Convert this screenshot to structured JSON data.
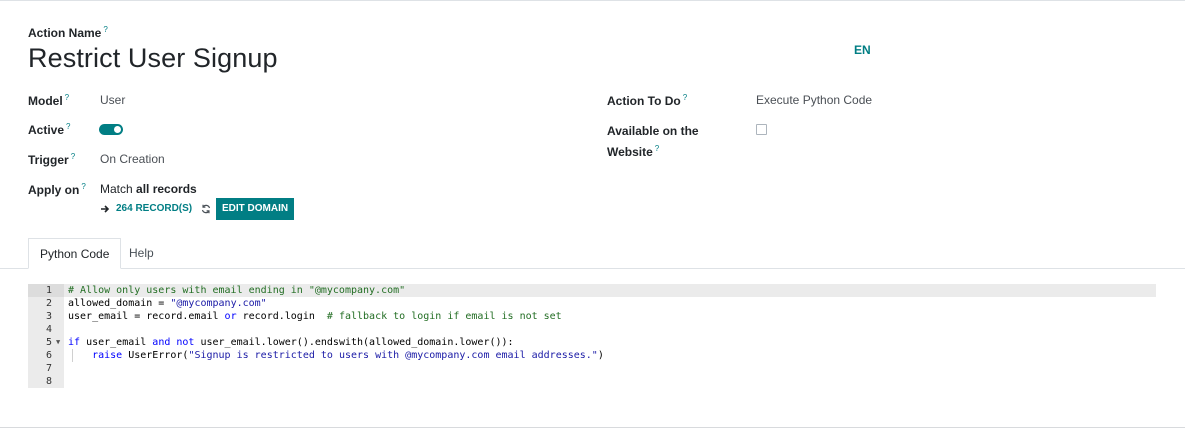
{
  "form": {
    "action_name_label": "Action Name",
    "action_name_help": "?",
    "title": "Restrict User Signup",
    "lang": "EN",
    "model_label": "Model",
    "model_value": "User",
    "active_label": "Active",
    "active_value": true,
    "trigger_label": "Trigger",
    "trigger_value": "On Creation",
    "apply_on_label": "Apply on",
    "apply_on_prefix": "Match ",
    "apply_on_bold": "all records",
    "records_link": "264 RECORD(S)",
    "edit_domain_label": "EDIT DOMAIN",
    "action_to_do_label": "Action To Do",
    "action_to_do_value": "Execute Python Code",
    "available_website_label_line1": "Available on the",
    "available_website_label_line2": "Website",
    "available_website_value": false,
    "help_mark": "?"
  },
  "tabs": [
    {
      "label": "Python Code",
      "active": true
    },
    {
      "label": "Help",
      "active": false
    }
  ],
  "code": {
    "line_numbers": [
      "1",
      "2",
      "3",
      "4",
      "5",
      "6",
      "7",
      "8"
    ],
    "active_line": 1,
    "lines": [
      "# Allow only users with email ending in \"@mycompany.com\"",
      "allowed_domain = \"@mycompany.com\"",
      "user_email = record.email or record.login  # fallback to login if email is not set",
      "",
      "if user_email and not user_email.lower().endswith(allowed_domain.lower()):",
      "    raise UserError(\"Signup is restricted to users with @mycompany.com email addresses.\")",
      "",
      ""
    ]
  },
  "colors": {
    "accent": "#017e84",
    "comment": "#236e24",
    "string": "#1a1aa6",
    "keyword": "#0000ff"
  },
  "icons": {
    "records_arrow": "arrow-right-icon",
    "refresh": "refresh-icon",
    "fold": "chevron-down-icon"
  }
}
